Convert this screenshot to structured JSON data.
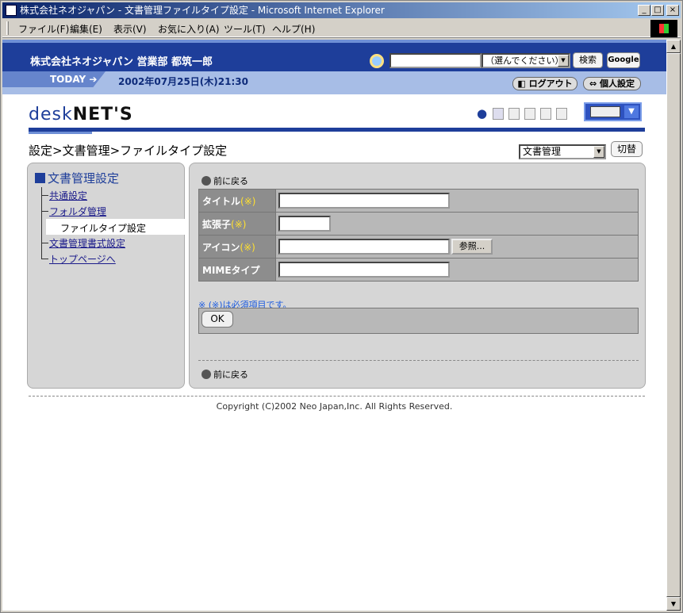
{
  "window": {
    "title": "株式会社ネオジャパン - 文書管理ファイルタイプ設定 - Microsoft Internet Explorer",
    "minimize": "_",
    "maximize": "□",
    "close": "×"
  },
  "menubar": [
    "ファイル(F)",
    "編集(E)",
    "表示(V)",
    "お気に入り(A)",
    "ツール(T)",
    "ヘルプ(H)"
  ],
  "header": {
    "user": "株式会社ネオジャパン  営業部  都筑一郎",
    "search_select": "（選んでください）",
    "search_button": "検索",
    "google_button": "Google",
    "today_label": "TODAY",
    "today_date": "2002年07月25日(木)21:30",
    "logout_button": "ログアウト",
    "personal_settings_button": "個人設定"
  },
  "logo": {
    "part1": "desk",
    "part2": "NET'S"
  },
  "breadcrumb": "設定>文書管理>ファイルタイプ設定",
  "app_select": "文書管理",
  "switch_button": "切替",
  "sidebar": {
    "title": "文書管理設定",
    "items": [
      {
        "label": "共通設定"
      },
      {
        "label": "フォルダ管理"
      },
      {
        "label": "ファイルタイプ設定"
      },
      {
        "label": "文書管理書式設定"
      },
      {
        "label": "トップページへ"
      }
    ]
  },
  "main": {
    "back_top": "前に戻る",
    "back_bottom": "前に戻る",
    "required_mark": "(※)",
    "fields": [
      {
        "label": "タイトル",
        "value": ""
      },
      {
        "label": "拡張子",
        "value": ""
      },
      {
        "label": "アイコン",
        "value": ""
      },
      {
        "label": "MIMEタイプ",
        "value": ""
      }
    ],
    "browse_button": "参照...",
    "note": "※ (※)は必須項目です。",
    "ok_button": "OK"
  },
  "footer": {
    "copyright": "Copyright (C)2002 Neo Japan,Inc. All Rights Reserved."
  },
  "colors": {
    "header_blue": "#1e3e9a",
    "today_bar": "#a7bde6",
    "panel_gray": "#d6d6d6",
    "label_gray": "#8d8d8d"
  }
}
